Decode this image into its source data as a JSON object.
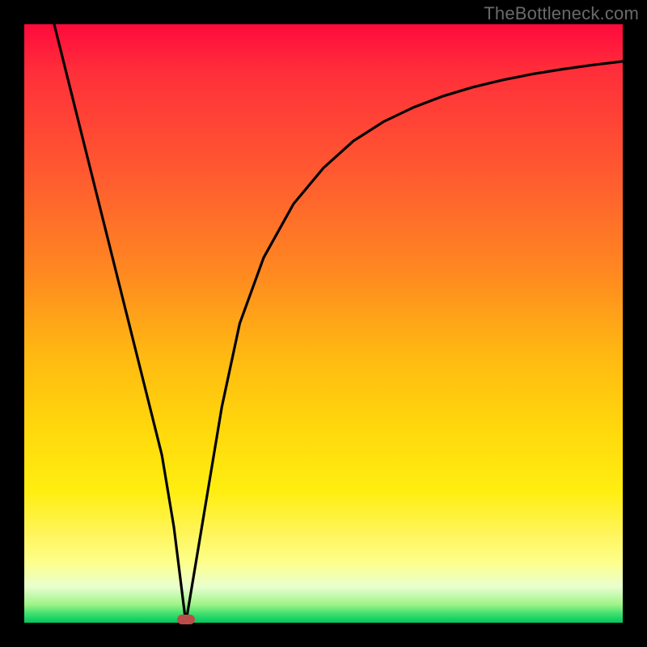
{
  "watermark": "TheBottleneck.com",
  "chart_data": {
    "type": "line",
    "title": "",
    "xlabel": "",
    "ylabel": "",
    "xlim": [
      0,
      100
    ],
    "ylim": [
      0,
      100
    ],
    "grid": false,
    "series": [
      {
        "name": "curve",
        "x": [
          5,
          8,
          11,
          14,
          17,
          20,
          23,
          25,
          27,
          30,
          33,
          36,
          40,
          45,
          50,
          55,
          60,
          65,
          70,
          75,
          80,
          85,
          90,
          95,
          100
        ],
        "y": [
          100,
          88,
          76,
          64,
          52,
          40,
          28,
          16,
          0,
          18,
          36,
          50,
          61,
          70,
          76,
          80.5,
          83.7,
          86.1,
          88,
          89.5,
          90.7,
          91.7,
          92.5,
          93.2,
          93.8
        ]
      }
    ],
    "annotations": [
      {
        "name": "min-marker",
        "x": 27,
        "y": 0
      }
    ]
  }
}
